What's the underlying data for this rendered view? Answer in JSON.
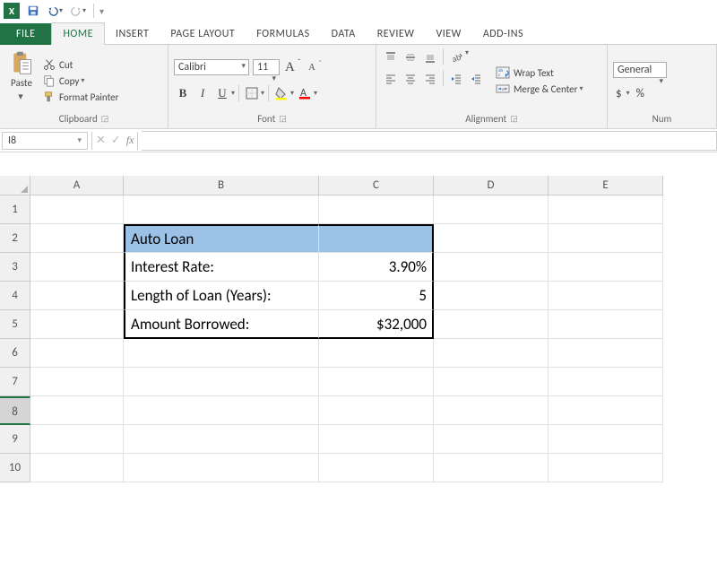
{
  "qat": {
    "app": "X"
  },
  "tabs": {
    "file": "FILE",
    "items": [
      "HOME",
      "INSERT",
      "PAGE LAYOUT",
      "FORMULAS",
      "DATA",
      "REVIEW",
      "VIEW",
      "ADD-INS"
    ],
    "active": 0
  },
  "ribbon": {
    "clipboard": {
      "label": "Clipboard",
      "paste": "Paste",
      "cut": "Cut",
      "copy": "Copy",
      "format_painter": "Format Painter"
    },
    "font": {
      "label": "Font",
      "name": "Calibri",
      "size": "11",
      "increase": "A",
      "decrease": "A",
      "bold": "B",
      "italic": "I",
      "underline": "U"
    },
    "alignment": {
      "label": "Alignment",
      "wrap": "Wrap Text",
      "merge": "Merge & Center"
    },
    "number": {
      "label": "Num",
      "format": "General",
      "currency": "$",
      "percent": "%"
    }
  },
  "formula_bar": {
    "cell_ref": "I8",
    "fx": "fx",
    "value": ""
  },
  "grid": {
    "columns": [
      "A",
      "B",
      "C",
      "D",
      "E"
    ],
    "rows": [
      "1",
      "2",
      "3",
      "4",
      "5",
      "6",
      "7",
      "8",
      "9",
      "10"
    ],
    "selected_row": 8
  },
  "loan": {
    "title": "Auto Loan",
    "rows": [
      {
        "label": "Interest Rate:",
        "value": "3.90%"
      },
      {
        "label": "Length of Loan (Years):",
        "value": "5"
      },
      {
        "label": "Amount Borrowed:",
        "value": "$32,000"
      }
    ]
  }
}
